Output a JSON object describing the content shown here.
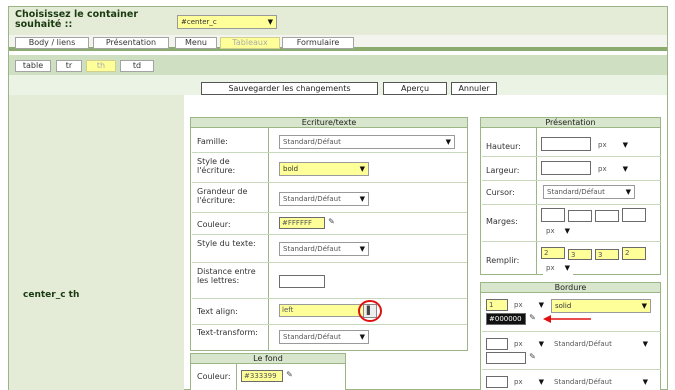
{
  "header": {
    "title": "Choisissez le container souhaité ::",
    "container_select": "#center_c"
  },
  "tabs_main": [
    "Body / liens",
    "Présentation",
    "Menu",
    "Tableaux",
    "Formulaire"
  ],
  "tabs_sub": [
    "table",
    "tr",
    "th",
    "td"
  ],
  "actions": {
    "save": "Sauvegarder les changements",
    "preview": "Aperçu",
    "cancel": "Annuler"
  },
  "element_label": "center_c th",
  "writing": {
    "title": "Ecriture/texte",
    "family_label": "Famille:",
    "family_value": "Standard/Défaut",
    "style_label": "Style de l'écriture:",
    "style_value": "bold",
    "size_label": "Grandeur de l'écriture:",
    "size_value": "Standard/Défaut",
    "color_label": "Couleur:",
    "color_value": "#FFFFFF",
    "textstyle_label": "Style du texte:",
    "textstyle_value": "Standard/Défaut",
    "spacing_label": "Distance entre les lettres:",
    "align_label": "Text align:",
    "align_value": "left",
    "transform_label": "Text-transform:",
    "transform_value": "Standard/Défaut"
  },
  "background": {
    "title": "Le fond",
    "color_label": "Couleur:",
    "color_value": "#333399"
  },
  "presentation": {
    "title": "Présentation",
    "height_label": "Hauteur:",
    "width_label": "Largeur:",
    "cursor_label": "Cursor:",
    "cursor_value": "Standard/Défaut",
    "margins_label": "Marges:",
    "padding_label": "Remplir:",
    "padding_values": [
      "2",
      "3",
      "3",
      "2"
    ],
    "unit": "px"
  },
  "border": {
    "title": "Bordure",
    "width_value": "1",
    "unit": "px",
    "style_value": "solid",
    "color_value": "#000000",
    "style2": "Standard/Défaut",
    "style3": "Standard/Défaut"
  },
  "colors": {
    "green_header": "#d8e6cd",
    "green_panel": "#e4ecd8",
    "highlight": "#ffff99",
    "annotation_red": "#e01010"
  }
}
